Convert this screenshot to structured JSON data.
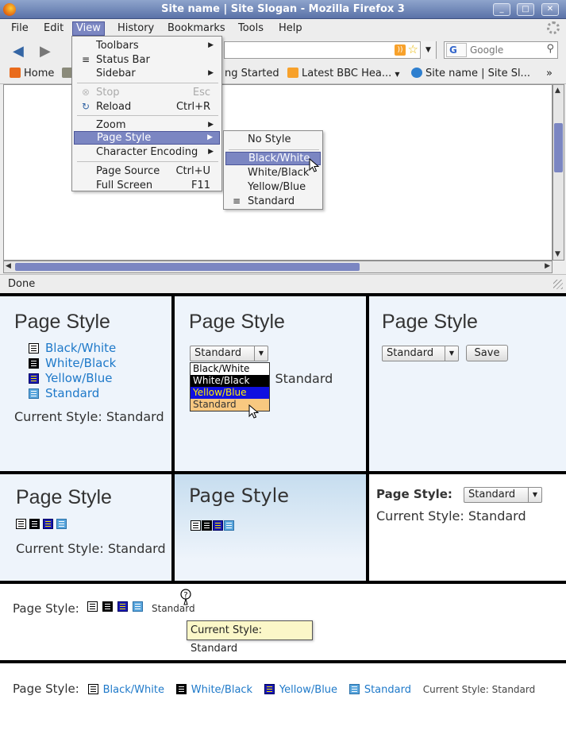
{
  "window": {
    "title": "Site name | Site Slogan - Mozilla Firefox 3",
    "controls": [
      "_",
      "□",
      "✕"
    ]
  },
  "menubar": [
    "File",
    "Edit",
    "View",
    "History",
    "Bookmarks",
    "Tools",
    "Help"
  ],
  "navbar": {
    "search_placeholder": "Google",
    "search_engine": "G"
  },
  "bookmarks": [
    "Home",
    "ng Started",
    "Latest BBC Hea...",
    "Site name | Site Sl...",
    "»"
  ],
  "status": "Done",
  "view_menu": {
    "items": [
      {
        "label": "Toolbars",
        "shortcut": "",
        "submenu": true
      },
      {
        "label": "Status Bar",
        "shortcut": "",
        "submenu": false
      },
      {
        "label": "Sidebar",
        "shortcut": "",
        "submenu": true
      },
      {
        "label": "Stop",
        "shortcut": "Esc",
        "submenu": false
      },
      {
        "label": "Reload",
        "shortcut": "Ctrl+R",
        "submenu": false
      },
      {
        "label": "Zoom",
        "shortcut": "",
        "submenu": true
      },
      {
        "label": "Page Style",
        "shortcut": "",
        "submenu": true
      },
      {
        "label": "Character Encoding",
        "shortcut": "",
        "submenu": true
      },
      {
        "label": "Page Source",
        "shortcut": "Ctrl+U",
        "submenu": false
      },
      {
        "label": "Full Screen",
        "shortcut": "F11",
        "submenu": false
      }
    ]
  },
  "style_submenu": [
    "No Style",
    "Black/White",
    "White/Black",
    "Yellow/Blue",
    "Standard"
  ],
  "demos": {
    "heading": "Page Style",
    "heading_colon": "Page Style:",
    "current": "Current Style: Standard",
    "current_short": "Current Style: Standard",
    "current_frag": ": Standard",
    "options": [
      "Black/White",
      "White/Black",
      "Yellow/Blue",
      "Standard"
    ],
    "selected": "Standard",
    "save": "Save",
    "standard_small": "Standard",
    "tooltip": "Current Style: Standard"
  },
  "colors": {
    "link": "#1e79c9",
    "menu_highlight": "#7b86c2",
    "panel_bg": "#eef4fb"
  }
}
